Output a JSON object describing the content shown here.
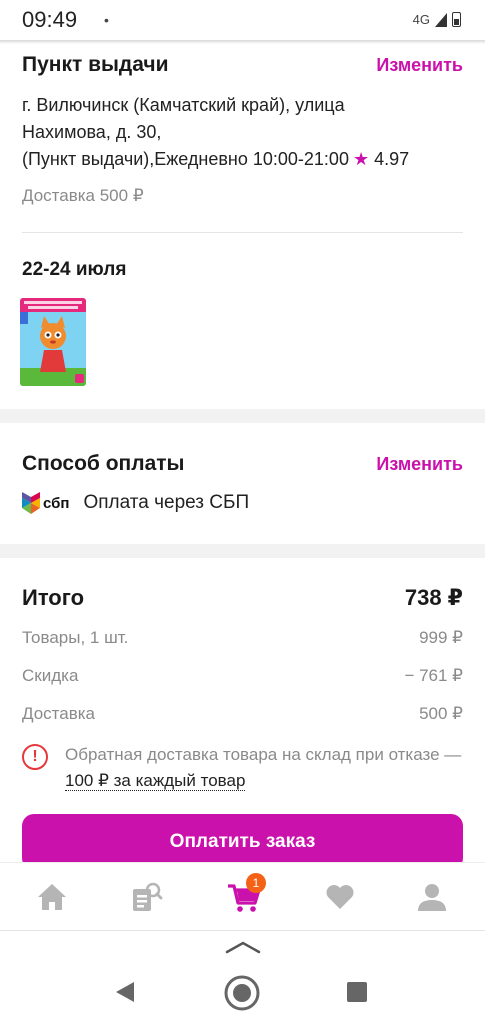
{
  "status_bar": {
    "time": "09:49",
    "dot": "•",
    "network": "4G"
  },
  "pickup": {
    "title": "Пункт выдачи",
    "change_label": "Изменить",
    "address_line1": "г. Вилючинск (Камчатский край), улица",
    "address_line2": "Нахимова, д. 30,",
    "address_line3": "(Пункт выдачи),Ежедневно 10:00-21:00",
    "rating": "4.97",
    "delivery_fee": "Доставка 500 ₽"
  },
  "shipment": {
    "date": "22-24 июля"
  },
  "payment": {
    "title": "Способ оплаты",
    "change_label": "Изменить",
    "sbp_logo_text": "сбп",
    "method": "Оплата через СБП"
  },
  "summary": {
    "total_label": "Итого",
    "total_value": "738 ₽",
    "items_label": "Товары, 1 шт.",
    "items_value": "999 ₽",
    "discount_label": "Скидка",
    "discount_value": "− 761 ₽",
    "delivery_label": "Доставка",
    "delivery_value": "500 ₽",
    "notice_icon": "!",
    "notice_text": "Обратная доставка товара на склад при отказе — ",
    "notice_link": "100 ₽ за каждый товар",
    "pay_button": "Оплатить заказ"
  },
  "bottom_nav": {
    "cart_count": "1",
    "accent_color": "#cb11ab"
  },
  "colors": {
    "accent": "#cb11ab",
    "badge": "#f56215",
    "warning": "#e6373b"
  }
}
